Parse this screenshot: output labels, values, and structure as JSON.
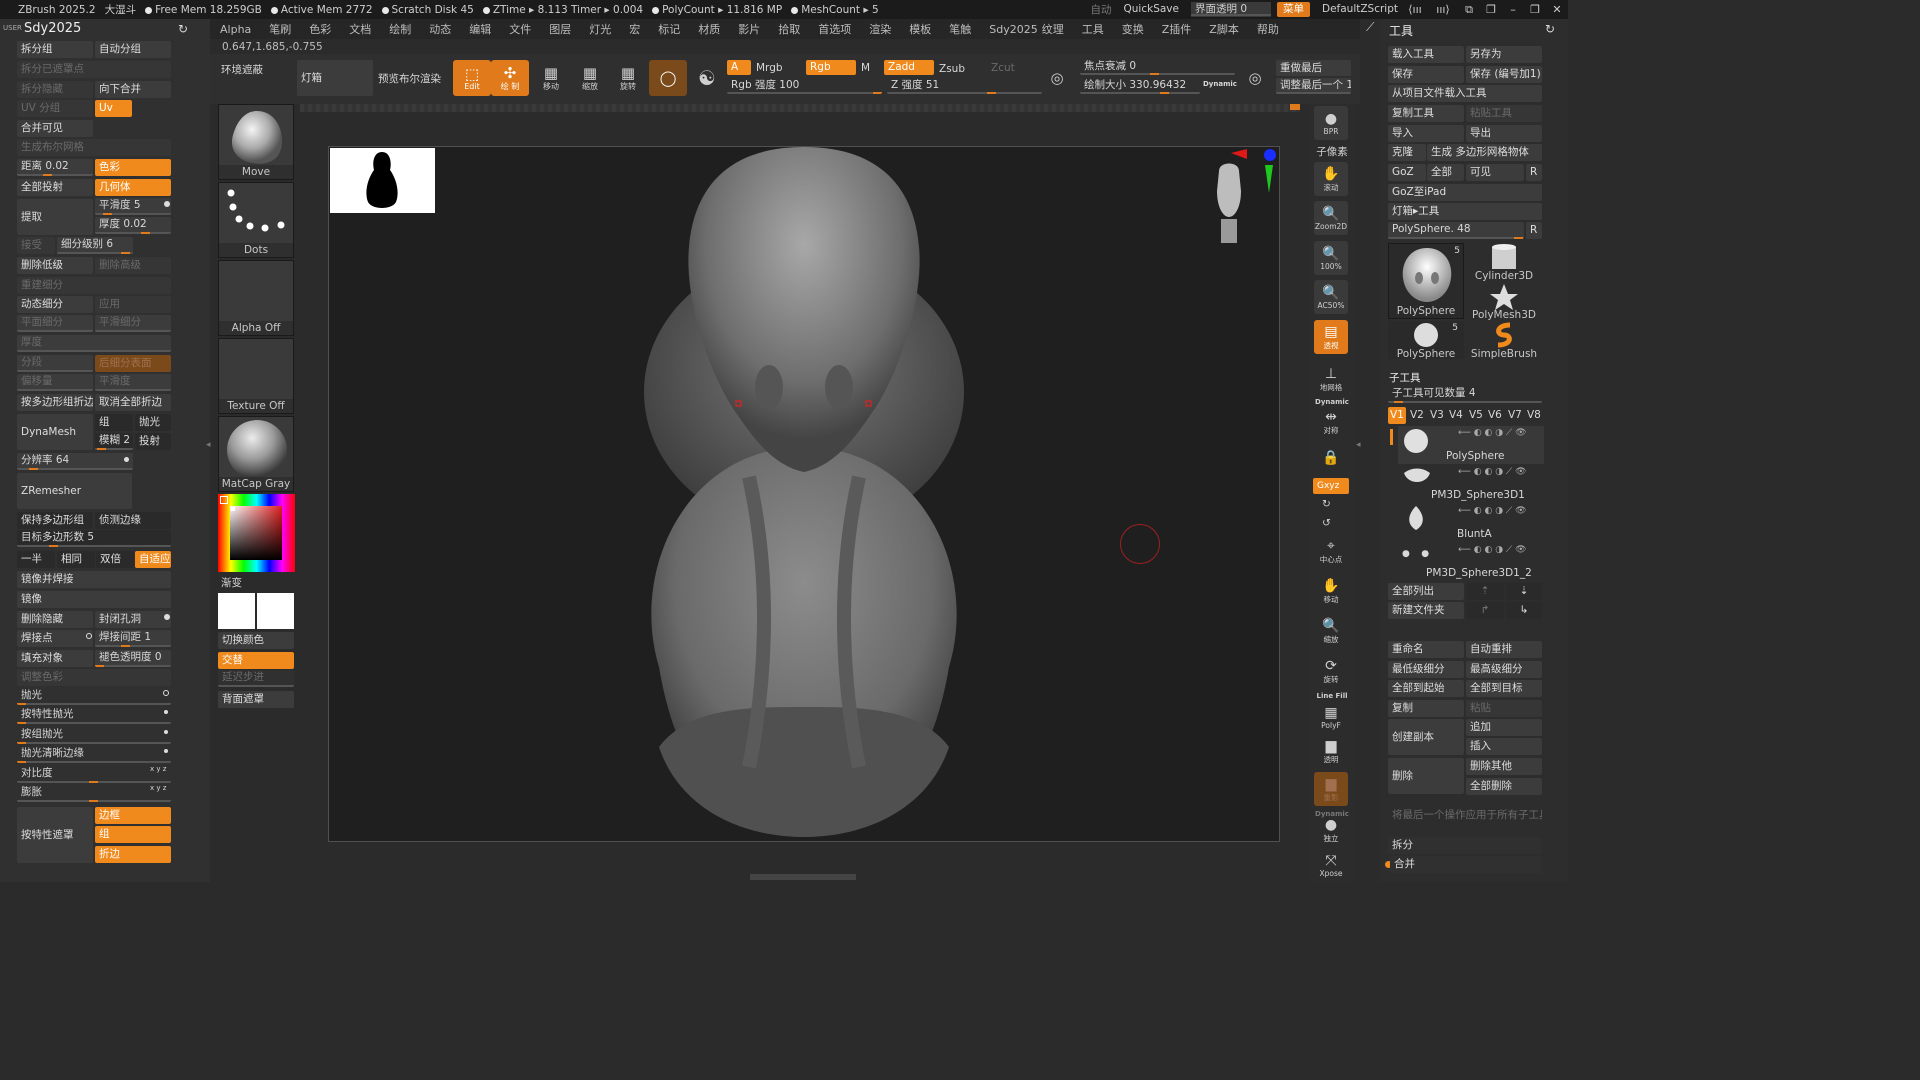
{
  "titlebar": {
    "app": "ZBrush 2025.2",
    "name": "大湿斗",
    "free_mem": "Free Mem 18.259GB",
    "active_mem": "Active Mem 2772",
    "scratch": "Scratch Disk 45",
    "ztime": "ZTime ▸ 8.113 Timer ▸ 0.004",
    "polycount": "PolyCount ▸ 11.816 MP",
    "meshcount": "MeshCount ▸ 5",
    "auto": "自动",
    "quicksave": "QuickSave",
    "transparency": "界面透明 0",
    "menu": "菜单",
    "script": "DefaultZScript"
  },
  "menubar": [
    "Alpha",
    "笔刷",
    "色彩",
    "文档",
    "绘制",
    "动态",
    "编辑",
    "文件",
    "图层",
    "灯光",
    "宏",
    "标记",
    "材质",
    "影片",
    "拾取",
    "首选项",
    "渲染",
    "模板",
    "笔触",
    "Sdy2025",
    "纹理",
    "工具",
    "变换",
    "Z插件",
    "Z脚本",
    "帮助"
  ],
  "coords": "0.647,1.685,-0.755",
  "left": {
    "user": "USER",
    "title": "Sdy2025",
    "r1": [
      "拆分组",
      "自动分组"
    ],
    "r2": "拆分已遮罩点",
    "r3": [
      "拆分隐藏",
      "向下合并"
    ],
    "r4": [
      "UV 分组",
      "Uv"
    ],
    "r5": "合并可见",
    "r6": "生成布尔网格",
    "r7": [
      "距离 0.02",
      "色彩"
    ],
    "r8": [
      "全部投射",
      "几何体"
    ],
    "extract": "提取",
    "smooth": "平滑度 5",
    "thick": "厚度 0.02",
    "r9": [
      "接受",
      "细分级别 6"
    ],
    "r10": [
      "删除低级",
      "删除高级"
    ],
    "r11": "重建细分",
    "r12": [
      "动态细分",
      "应用"
    ],
    "r13": [
      "平面细分",
      "平滑细分"
    ],
    "r14": "厚度",
    "r15": [
      "分段",
      "后细分表面"
    ],
    "r16": [
      "偏移量",
      "平滑度"
    ],
    "r17": [
      "按多边形组折边",
      "取消全部折边"
    ],
    "dynamesh": "DynaMesh",
    "dm": [
      "组",
      "抛光",
      "模糊 2",
      "投射"
    ],
    "res": "分辨率 64",
    "zrem": "ZRemesher",
    "r18": [
      "保持多边形组",
      "侦测边缘"
    ],
    "target": "目标多边形数 5",
    "r19": [
      "一半",
      "相同",
      "双倍",
      "自适应"
    ],
    "mirror_weld": "镜像并焊接",
    "mirror": "镜像",
    "r20": [
      "删除隐藏",
      "封闭孔洞"
    ],
    "r21": [
      "焊接点",
      "焊接间距 1"
    ],
    "r22": [
      "填充对象",
      "褪色透明度 0"
    ],
    "r23": "调整色彩",
    "polish": "抛光",
    "polish_feat": "按特性抛光",
    "polish_group": "按组抛光",
    "polish_crisp": "抛光清晰边缘",
    "contrast": "对比度",
    "inflate": "膨胀",
    "feat_mask": "按特性遮罩",
    "fm": [
      "边框",
      "组",
      "折边"
    ]
  },
  "shelf": {
    "lightbox": "环境遮蔽",
    "lightbox2": "灯箱",
    "preview": "预览布尔渲染",
    "edit": "Edit",
    "draw": "绘 制",
    "move": "移动",
    "scale": "缩放",
    "rotate": "旋转",
    "a": "A",
    "mrgb": "Mrgb",
    "rgb": "Rgb",
    "m": "M",
    "zadd": "Zadd",
    "zsub": "Zsub",
    "zcut": "Zcut",
    "rgb_int": "Rgb 强度 100",
    "z_int": "Z 强度 51",
    "focal": "焦点衰减 0",
    "draw_size": "绘制大小 330.96432",
    "dynamic": "Dynamic",
    "replay": "重做最后",
    "replay2": "调整最后一个 1"
  },
  "tools": [
    {
      "name": "Move"
    },
    {
      "name": "Dots"
    },
    {
      "name": "Alpha Off"
    },
    {
      "name": "Texture Off"
    },
    {
      "name": "MatCap Gray"
    }
  ],
  "gradient": "渐变",
  "switch": "切换颜色",
  "alternate": "交替",
  "delay": "延迟步进",
  "backmask": "背面遮罩",
  "rstrip": [
    {
      "l": "BPR"
    },
    {
      "l": "子像素"
    },
    {
      "l": "滚动"
    },
    {
      "l": "Zoom2D"
    },
    {
      "l": "100%"
    },
    {
      "l": "AC50%"
    },
    {
      "l": "透视"
    },
    {
      "l": "地网格"
    },
    {
      "l": "Dynamic"
    },
    {
      "l": "对称"
    },
    {
      "l": "Gxyz"
    },
    {
      "l": "中心点"
    },
    {
      "l": "移动"
    },
    {
      "l": "缩放"
    },
    {
      "l": "旋转"
    },
    {
      "l": "Line Fill"
    },
    {
      "l": "PolyF"
    },
    {
      "l": "透明"
    },
    {
      "l": "重影"
    },
    {
      "l": "Dynamic"
    },
    {
      "l": "独立"
    },
    {
      "l": "Xpose"
    }
  ],
  "right": {
    "title": "工具",
    "b": [
      [
        "载入工具",
        "另存为"
      ],
      [
        "保存",
        "保存 (编号加1)"
      ],
      [
        "从项目文件载入工具"
      ],
      [
        "复制工具",
        "粘贴工具"
      ],
      [
        "导入",
        "导出"
      ],
      [
        "克隆",
        "生成 多边形网格物体"
      ],
      [
        "GoZ",
        "全部",
        "可见",
        "R"
      ],
      [
        "GoZ至iPad"
      ],
      [
        "灯箱▸工具"
      ]
    ],
    "polysphere": "PolySphere. 48",
    "thumbs": [
      {
        "n": "PolySphere",
        "c": "5"
      },
      {
        "n": "Cylinder3D"
      },
      {
        "n": "PolyMesh3D"
      },
      {
        "n": "PolySphere",
        "c": "5"
      },
      {
        "n": "SimpleBrush"
      }
    ],
    "subtool": "子工具",
    "visible": "子工具可见数量 4",
    "v": [
      "V1",
      "V2",
      "V3",
      "V4",
      "V5",
      "V6",
      "V7",
      "V8"
    ],
    "subtools": [
      "PolySphere",
      "PM3D_Sphere3D1",
      "BluntA",
      "PM3D_Sphere3D1_2"
    ],
    "lb": [
      [
        "全部列出"
      ],
      [
        "新建文件夹"
      ],
      [
        "重命名",
        "自动重排"
      ],
      [
        "最低级细分",
        "最高级细分"
      ],
      [
        "全部到起始",
        "全部到目标"
      ],
      [
        "复制",
        "粘贴"
      ],
      [
        "创建副本",
        "追加",
        "插入"
      ],
      [
        "删除",
        "删除其他",
        "全部删除"
      ],
      [
        "将最后一个操作应用于所有子工具"
      ],
      [
        "拆分"
      ],
      [
        "合并"
      ]
    ]
  },
  "colors": {
    "accent": "#f08a1c",
    "canvas": "#1f1f1f",
    "panel": "#303030"
  }
}
